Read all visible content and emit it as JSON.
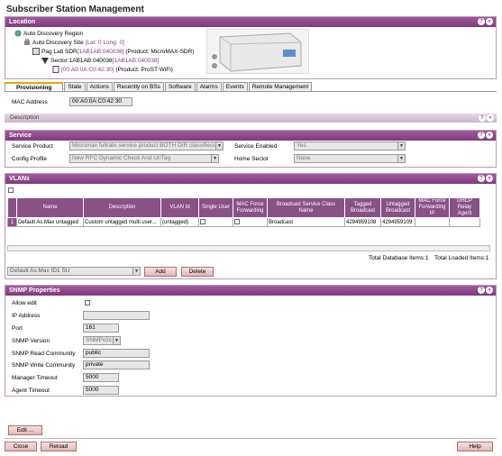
{
  "page_title": "Subscriber Station Management",
  "location": {
    "header": "Location",
    "tree": [
      {
        "label": "Auto Discovery Region",
        "extra": ""
      },
      {
        "label": "Auto Discovery Site",
        "extra": "[Lat: 0 Long: 0]"
      },
      {
        "label": "Pag Lab SDR",
        "extra": "[1AB1AB:040038]",
        "extra2": "[1AB1AB:040038]",
        "product": "(Product: MicroMAX-SDR)"
      },
      {
        "label": "Sector:1AB1AB:040038",
        "extra": "[1AB1AB:040038]"
      },
      {
        "label": "[00:A0:0A:C0:42:30]",
        "product": "(Product: ProST WiFi)"
      }
    ]
  },
  "tabs": [
    "Provisioning",
    "State",
    "Actions",
    "Recently on BSs",
    "Software",
    "Alarms",
    "Events",
    "Remote Management"
  ],
  "mac": {
    "label": "MAC Address",
    "value": "00:A0:0A:C0:42:30"
  },
  "description": {
    "label": "Description"
  },
  "service": {
    "header": "Service",
    "service_product_label": "Service Product",
    "service_product_value": "Micromax fullrate service product BOTH DIR classifiers",
    "config_profile_label": "Config Profile",
    "config_profile_value": "New RFC Dynamic Check And UnTag",
    "service_enabled_label": "Service Enabled",
    "service_enabled_value": "Yes",
    "home_sector_label": "Home Sector",
    "home_sector_value": "None"
  },
  "vlans": {
    "header": "VLANs",
    "columns": [
      "Name",
      "Description",
      "VLAN Id",
      "Single User",
      "MAC Force Forwarding",
      "Broadcast Service Class Name",
      "Tagged Broadcast",
      "Untagged Broadcast",
      "MAC Force Forwarding IP",
      "DHCP Relay Agent"
    ],
    "row": {
      "index": "1",
      "name": "Default As.Max untagged",
      "description": "Custom untagged multi user...",
      "vlan_id": "(untagged)",
      "bsc_name": "Broadcast",
      "tagged": "4294959108",
      "untagged": "4294959109"
    },
    "total_db": "Total Database Items:1",
    "total_loaded": "Total Loaded Items:1",
    "add_select_value": "Default As.Max ID1 SU",
    "add_label": "Add",
    "delete_label": "Delete"
  },
  "snmp": {
    "header": "SNMP Properties",
    "allow_edit_label": "Allow edit",
    "ip_label": "IP Address",
    "ip_value": "",
    "port_label": "Port",
    "port_value": "161",
    "version_label": "SNMP Version",
    "version_value": "SNMPv2c",
    "read_label": "SNMP Read Community",
    "read_value": "public",
    "write_label": "SNMP Write Community",
    "write_value": "private",
    "mgr_timeout_label": "Manager Timeout",
    "mgr_timeout_value": "5000",
    "agent_timeout_label": "Agent Timeout",
    "agent_timeout_value": "5000"
  },
  "buttons": {
    "edit": "Edit ...",
    "close": "Close",
    "reload": "Reload",
    "help": "Help"
  },
  "colors": {
    "header": "#7e3a7c",
    "accent": "#8b3a8b"
  }
}
